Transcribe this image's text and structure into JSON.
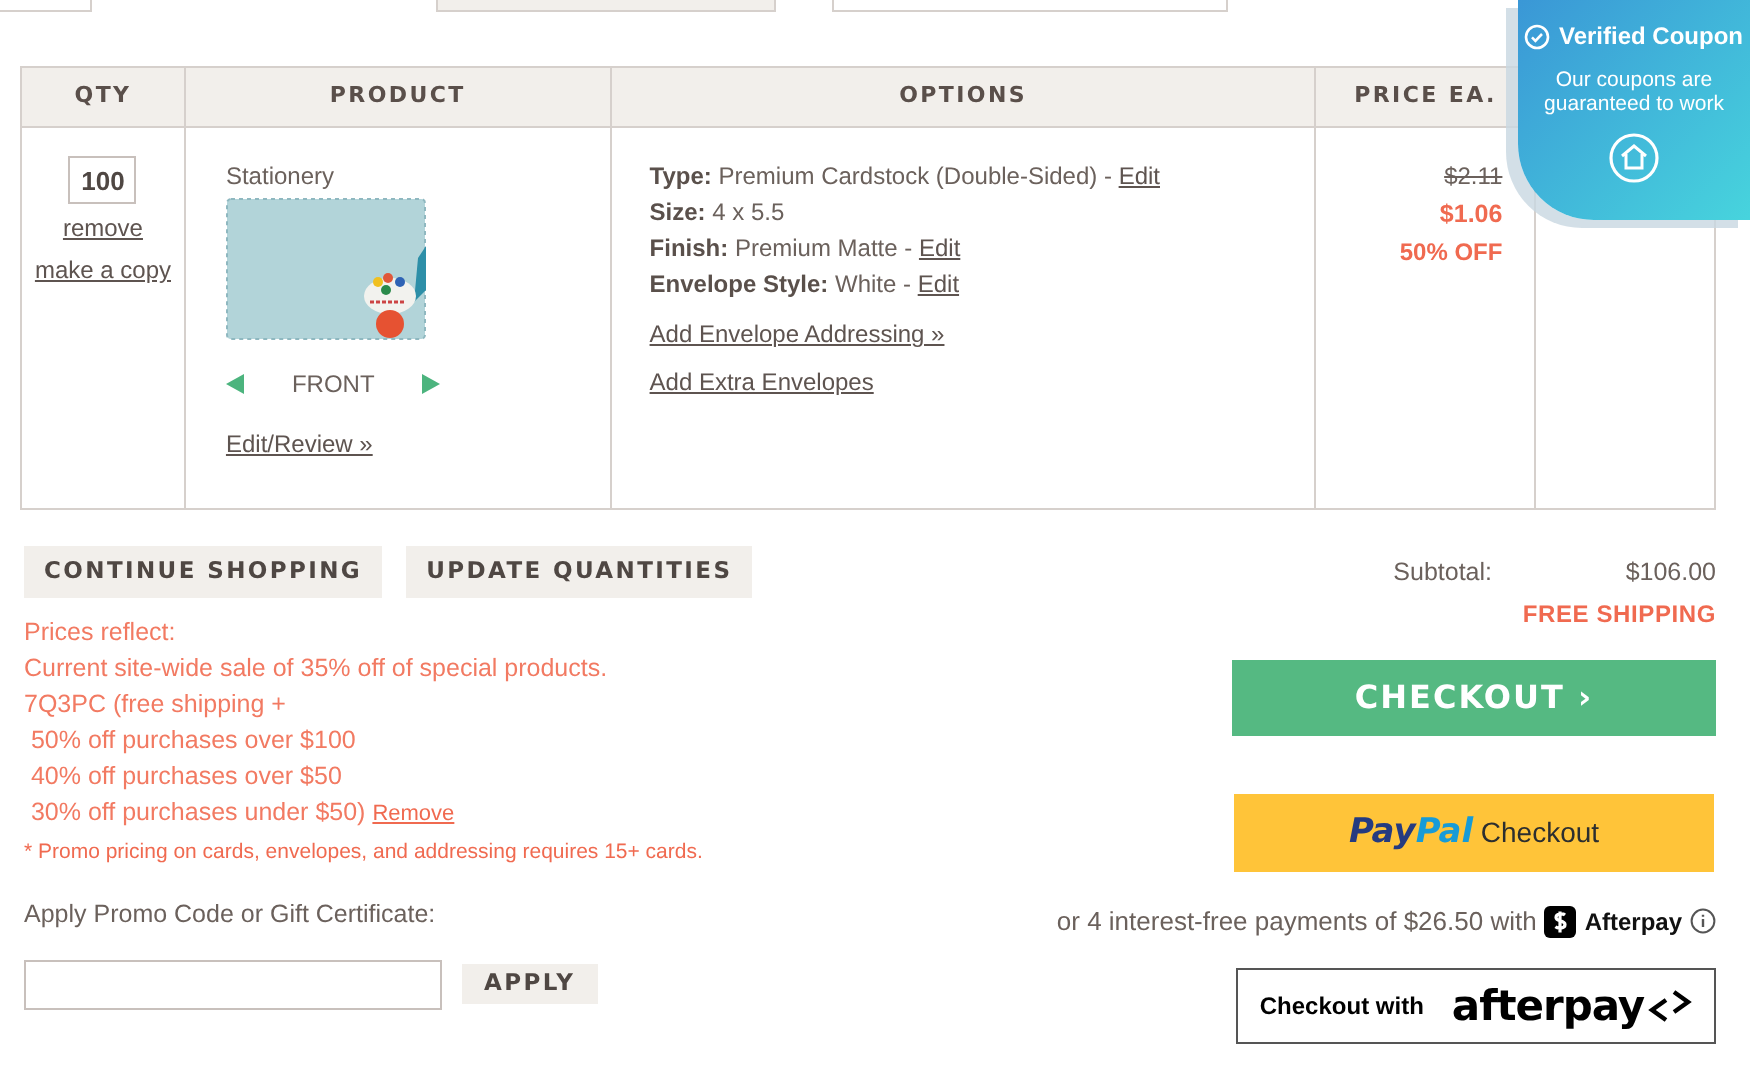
{
  "table": {
    "columns": [
      "QTY",
      "PRODUCT",
      "OPTIONS",
      "PRICE EA."
    ],
    "rows": [
      {
        "qty": "100",
        "qty_links": [
          "remove",
          "make a copy"
        ],
        "product": {
          "name": "Stationery",
          "side": "FRONT",
          "edit_link": "Edit/Review »"
        },
        "options": [
          {
            "label": "Type:",
            "value": "Premium Cardstock (Double-Sided) -",
            "link": "Edit"
          },
          {
            "label": "Size:",
            "value": "4 x 5.5"
          },
          {
            "label": "Finish:",
            "value": "Premium Matte -",
            "link": "Edit"
          },
          {
            "label": "Envelope Style:",
            "value": "White -",
            "link": "Edit"
          }
        ],
        "option_links": [
          "Add Envelope Addressing »",
          "Add Extra Envelopes"
        ],
        "price": {
          "original": "$2.11",
          "sale": "$1.06",
          "discount": "50% OFF"
        }
      }
    ]
  },
  "cart_buttons": [
    "CONTINUE SHOPPING",
    "UPDATE QUANTITIES"
  ],
  "promo_notes": [
    "Prices reflect:",
    "Current site-wide sale of 35% off of special products.",
    "7Q3PC (free shipping +",
    " 50% off purchases over $100",
    " 40% off purchases over $50",
    " 30% off purchases under $50)"
  ],
  "promo_remove_link": "Remove",
  "promo_footnote": "* Promo pricing on cards, envelopes, and addressing requires 15+ cards.",
  "promo_code": {
    "label": "Apply Promo Code or Gift Certificate:",
    "button": "APPLY"
  },
  "summary": {
    "subtotal_label": "Subtotal:",
    "subtotal_value": "$106.00",
    "shipping": "FREE SHIPPING"
  },
  "checkout_button": "CHECKOUT ›",
  "paypal_button": {
    "logo_pay": "Pay",
    "logo_pal": "Pal",
    "label": "Checkout"
  },
  "afterpay_note": {
    "text": "or 4 interest-free payments of $26.50 with",
    "brand": "Afterpay"
  },
  "afterpay_button": {
    "label": "Checkout with",
    "brand": "afterpay"
  },
  "coupon_widget": {
    "title": "Verified Coupon",
    "message": "Our coupons are guaranteed to work"
  }
}
